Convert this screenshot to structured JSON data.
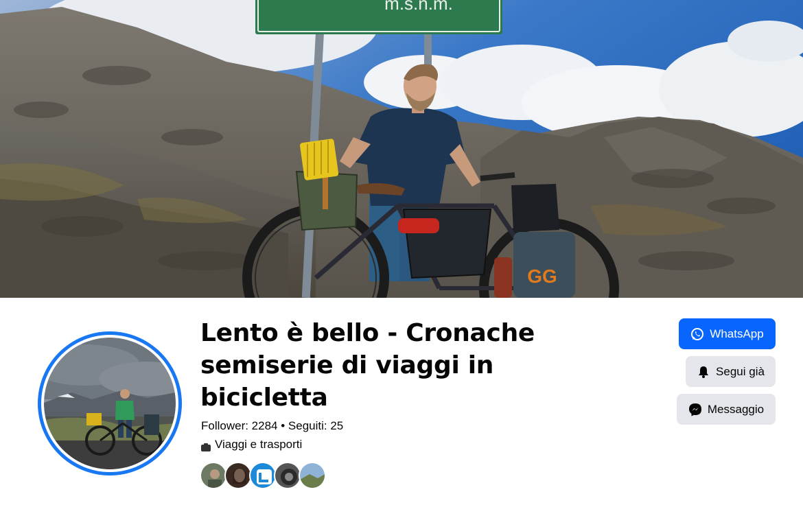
{
  "page": {
    "title": "Lento è bello - Cronache semiserie di viaggi in bicicletta",
    "stats": "Follower: 2284 • Seguiti: 25",
    "category": "Viaggi e trasporti"
  },
  "cover": {
    "sign_text": "m.s.n.m.",
    "bag_logo": "GG"
  },
  "actions": {
    "whatsapp_label": "WhatsApp",
    "follow_label": "Segui già",
    "message_label": "Messaggio"
  },
  "colors": {
    "primary_blue": "#0866ff",
    "avatar_ring": "#1877f2",
    "secondary_button": "#e4e6eb"
  },
  "icons": {
    "whatsapp": "whatsapp-icon",
    "follow": "bell-icon",
    "message": "messenger-icon",
    "category": "category-icon"
  }
}
